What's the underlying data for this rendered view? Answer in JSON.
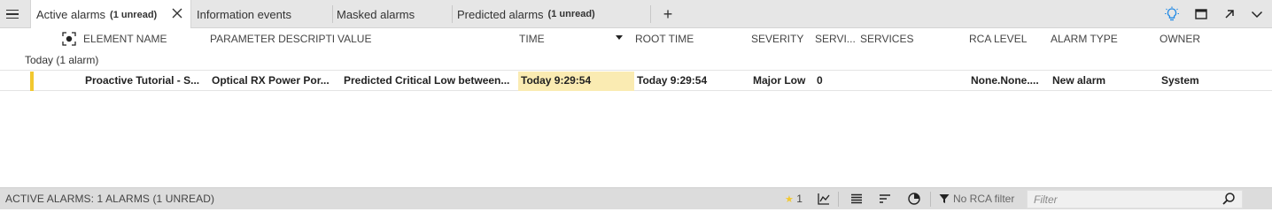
{
  "tabs": [
    {
      "label": "Active alarms",
      "unread": "(1 unread)",
      "active": true
    },
    {
      "label": "Information events",
      "unread": ""
    },
    {
      "label": "Masked alarms",
      "unread": ""
    },
    {
      "label": "Predicted alarms",
      "unread": "(1 unread)"
    }
  ],
  "toolbar_icons": [
    "lightbulb-icon",
    "window-icon",
    "popout-icon",
    "chevron-down-icon"
  ],
  "columns": {
    "element_name": "ELEMENT NAME",
    "parameter_description": "PARAMETER DESCRIPTI...",
    "value": "VALUE",
    "time": "TIME",
    "root_time": "ROOT TIME",
    "severity": "SEVERITY",
    "servi": "SERVI...",
    "services": "SERVICES",
    "rca_level": "RCA LEVEL",
    "alarm_type": "ALARM TYPE",
    "owner": "OWNER"
  },
  "group": {
    "label": "Today (1 alarm)"
  },
  "rows": [
    {
      "element_name": "Proactive Tutorial - S...",
      "parameter_description": "Optical RX Power Por...",
      "value": "Predicted Critical Low between...",
      "time": "Today 9:29:54",
      "root_time": "Today 9:29:54",
      "severity": "Major Low",
      "servi": "0",
      "services": "",
      "rca_level": "None.None....",
      "alarm_type": "New alarm",
      "owner": "System",
      "severity_color": "#f2c82f"
    }
  ],
  "status": {
    "summary": "ACTIVE ALARMS: 1 ALARMS (1 UNREAD)",
    "star_count": "1",
    "rca_filter": "No RCA filter",
    "filter_placeholder": "Filter"
  },
  "colors": {
    "accent": "#1e88e5",
    "highlight": "#faebb2",
    "severity_major": "#f2c82f"
  }
}
